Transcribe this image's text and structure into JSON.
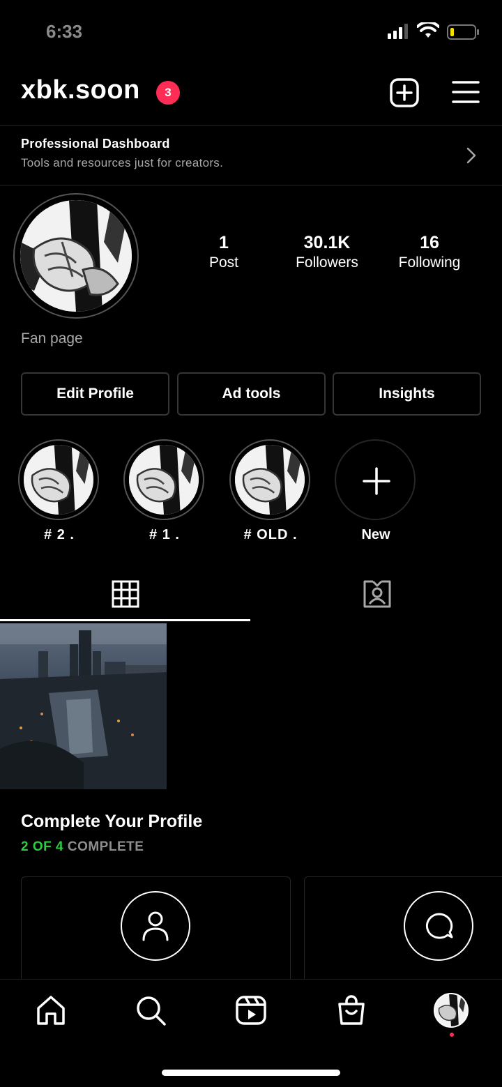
{
  "status_bar": {
    "time": "6:33"
  },
  "header": {
    "username": "xbk.soon",
    "notification_count": "3"
  },
  "dashboard": {
    "title": "Professional Dashboard",
    "subtitle": "Tools and resources just for creators."
  },
  "profile": {
    "stats": [
      {
        "value": "1",
        "label": "Post"
      },
      {
        "value": "30.1K",
        "label": "Followers"
      },
      {
        "value": "16",
        "label": "Following"
      }
    ],
    "bio": "Fan page"
  },
  "buttons": {
    "edit_profile": "Edit Profile",
    "ad_tools": "Ad tools",
    "insights": "Insights"
  },
  "highlights": [
    {
      "label": "# 2 ."
    },
    {
      "label": "# 1 ."
    },
    {
      "label": "# OLD ."
    },
    {
      "label": "New"
    }
  ],
  "complete_profile": {
    "title": "Complete Your Profile",
    "progress_done": "2 OF 4",
    "progress_suffix": " COMPLETE"
  },
  "colors": {
    "accent_badge": "#ff2d55",
    "progress_green": "#2ecc40",
    "battery_low": "#f5e100"
  },
  "icons": [
    "add-post-icon",
    "menu-icon",
    "chevron-right-icon",
    "grid-icon",
    "tagged-icon",
    "profile-icon",
    "chat-icon",
    "home-icon",
    "search-icon",
    "reels-icon",
    "shop-icon"
  ]
}
